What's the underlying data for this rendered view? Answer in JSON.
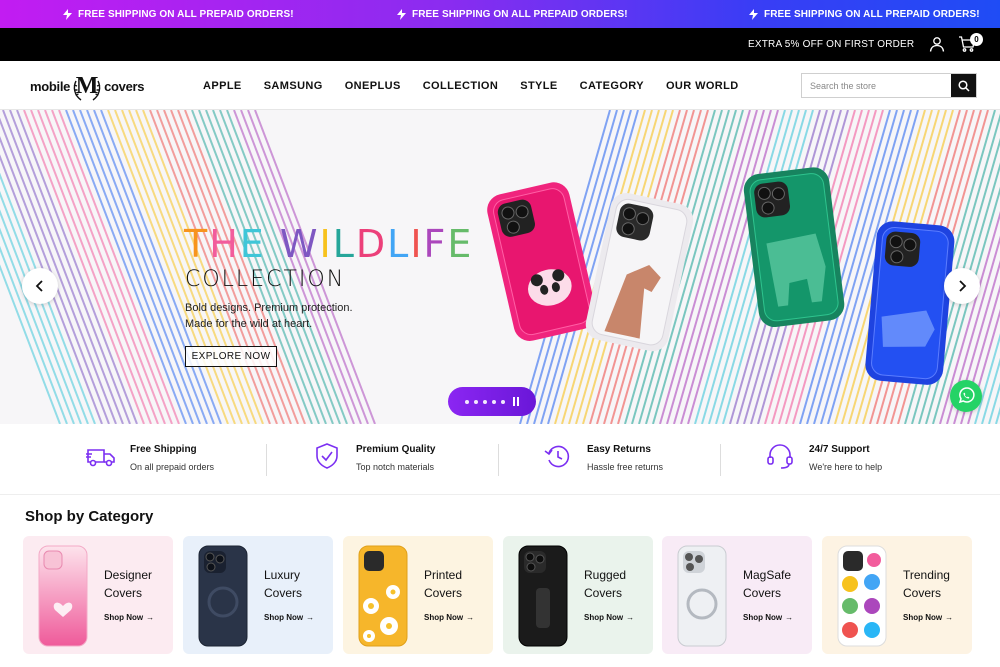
{
  "promo_bar": {
    "messages": [
      "FREE SHIPPING ON ALL PREPAID ORDERS!",
      "FREE SHIPPING ON ALL PREPAID ORDERS!",
      "FREE SHIPPING ON ALL PREPAID ORDERS!"
    ],
    "icon": "lightning-icon",
    "gradient": [
      "#c21cf2",
      "#1f4cf5"
    ]
  },
  "top_bar": {
    "offer": "EXTRA 5% OFF ON FIRST ORDER",
    "cart_count": "0"
  },
  "header": {
    "logo": {
      "left": "mobile",
      "mark": "M",
      "right": "covers"
    },
    "nav": [
      "APPLE",
      "SAMSUNG",
      "ONEPLUS",
      "COLLECTION",
      "STYLE",
      "CATEGORY",
      "OUR WORLD"
    ],
    "search_placeholder": "Search the store"
  },
  "hero": {
    "title": "THE WILDLIFE",
    "title_colors": [
      "#f7941d",
      "#f25c9c",
      "#3fc6d8",
      "#7e57c2",
      "#f7c21d",
      "#26a69a",
      "#ec407a",
      "#42a5f5",
      "#ef5350",
      "#ab47bc",
      "#66bb6a",
      "#29b6f6"
    ],
    "subtitle": "COLLECTION",
    "description": [
      "Bold designs. Premium protection.",
      "Made for the wild at heart."
    ],
    "cta": "EXPLORE NOW",
    "slides": 5,
    "accent": "#7a1ee6"
  },
  "features": [
    {
      "title": "Free Shipping",
      "subtitle": "On all prepaid orders",
      "icon": "truck-icon"
    },
    {
      "title": "Premium Quality",
      "subtitle": "Top notch materials",
      "icon": "shield-check-icon"
    },
    {
      "title": "Easy Returns",
      "subtitle": "Hassle free returns",
      "icon": "return-icon"
    },
    {
      "title": "24/7 Support",
      "subtitle": "We're here to help",
      "icon": "headset-icon"
    }
  ],
  "categories_section": {
    "title": "Shop by Category",
    "shop_now": "Shop Now",
    "items": [
      {
        "line1": "Designer",
        "line2": "Covers",
        "bg": "#fcebf1"
      },
      {
        "line1": "Luxury",
        "line2": "Covers",
        "bg": "#e8f0fa"
      },
      {
        "line1": "Printed",
        "line2": "Covers",
        "bg": "#fdf4e1"
      },
      {
        "line1": "Rugged",
        "line2": "Covers",
        "bg": "#eaf3ec"
      },
      {
        "line1": "MagSafe",
        "line2": "Covers",
        "bg": "#f8ebf6"
      },
      {
        "line1": "Trending",
        "line2": "Covers",
        "bg": "#fdf3e3"
      }
    ]
  }
}
